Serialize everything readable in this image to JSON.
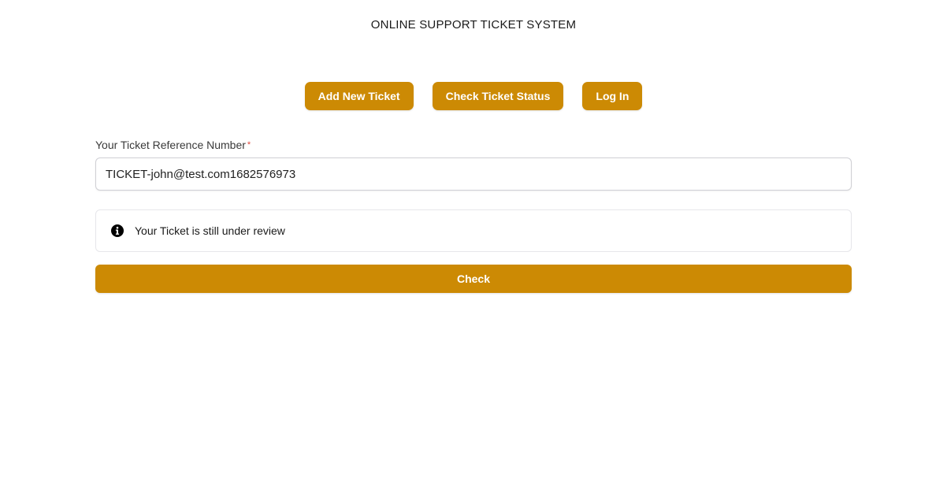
{
  "header": {
    "title": "ONLINE SUPPORT TICKET SYSTEM"
  },
  "nav": {
    "add_ticket_label": "Add New Ticket",
    "check_status_label": "Check Ticket Status",
    "login_label": "Log In"
  },
  "form": {
    "reference_label": "Your Ticket Reference Number",
    "required_marker": "*",
    "reference_value": "TICKET-john@test.com1682576973"
  },
  "alert": {
    "icon": "info-circle-icon",
    "message": "Your Ticket is still under review"
  },
  "actions": {
    "check_label": "Check"
  },
  "theme": {
    "accent": "#cc8a04",
    "required_color": "#e0453a"
  }
}
